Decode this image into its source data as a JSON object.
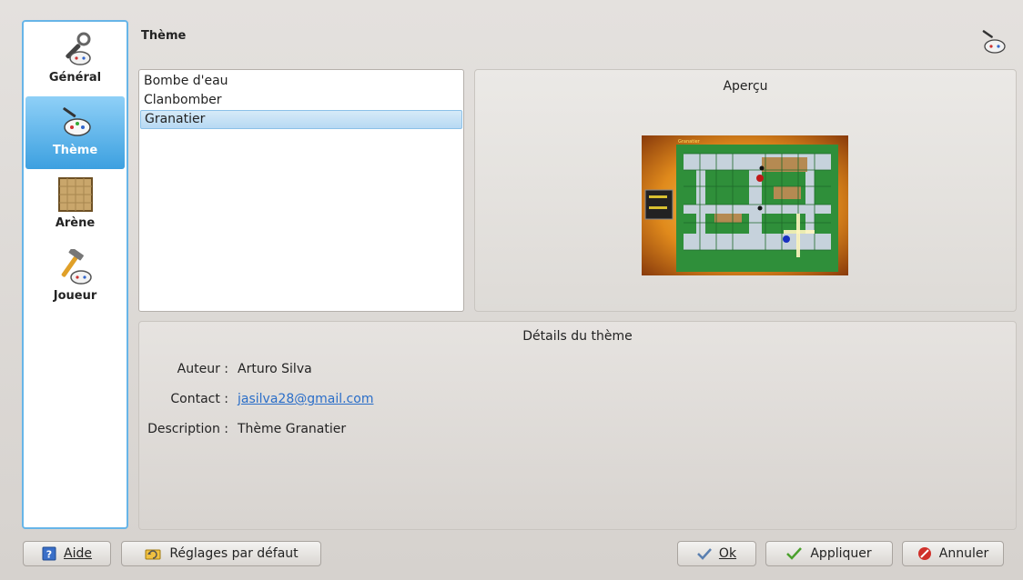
{
  "header": {
    "title": "Thème"
  },
  "sidebar": {
    "items": [
      {
        "label": "Général",
        "icon": "wrench-gamepad-icon"
      },
      {
        "label": "Thème",
        "icon": "brush-gamepad-icon",
        "active": true
      },
      {
        "label": "Arène",
        "icon": "arena-tile-icon"
      },
      {
        "label": "Joueur",
        "icon": "hammer-gamepad-icon"
      }
    ]
  },
  "themes": {
    "items": [
      "Bombe d'eau",
      "Clanbomber",
      "Granatier"
    ],
    "selected": "Granatier"
  },
  "preview": {
    "title": "Aperçu",
    "image_title": "Granatier"
  },
  "details": {
    "title": "Détails du thème",
    "author_label": "Auteur :",
    "author_value": "Arturo Silva",
    "contact_label": "Contact :",
    "contact_value": "jasilva28@gmail.com",
    "description_label": "Description :",
    "description_value": "Thème Granatier"
  },
  "buttons": {
    "help": "Aide",
    "defaults": "Réglages par défaut",
    "ok": "Ok",
    "apply": "Appliquer",
    "cancel": "Annuler"
  },
  "colors": {
    "accent": "#3ca0e0",
    "link": "#2a6ec8",
    "cancel_red": "#d0302a",
    "check_green": "#4aa02c"
  }
}
